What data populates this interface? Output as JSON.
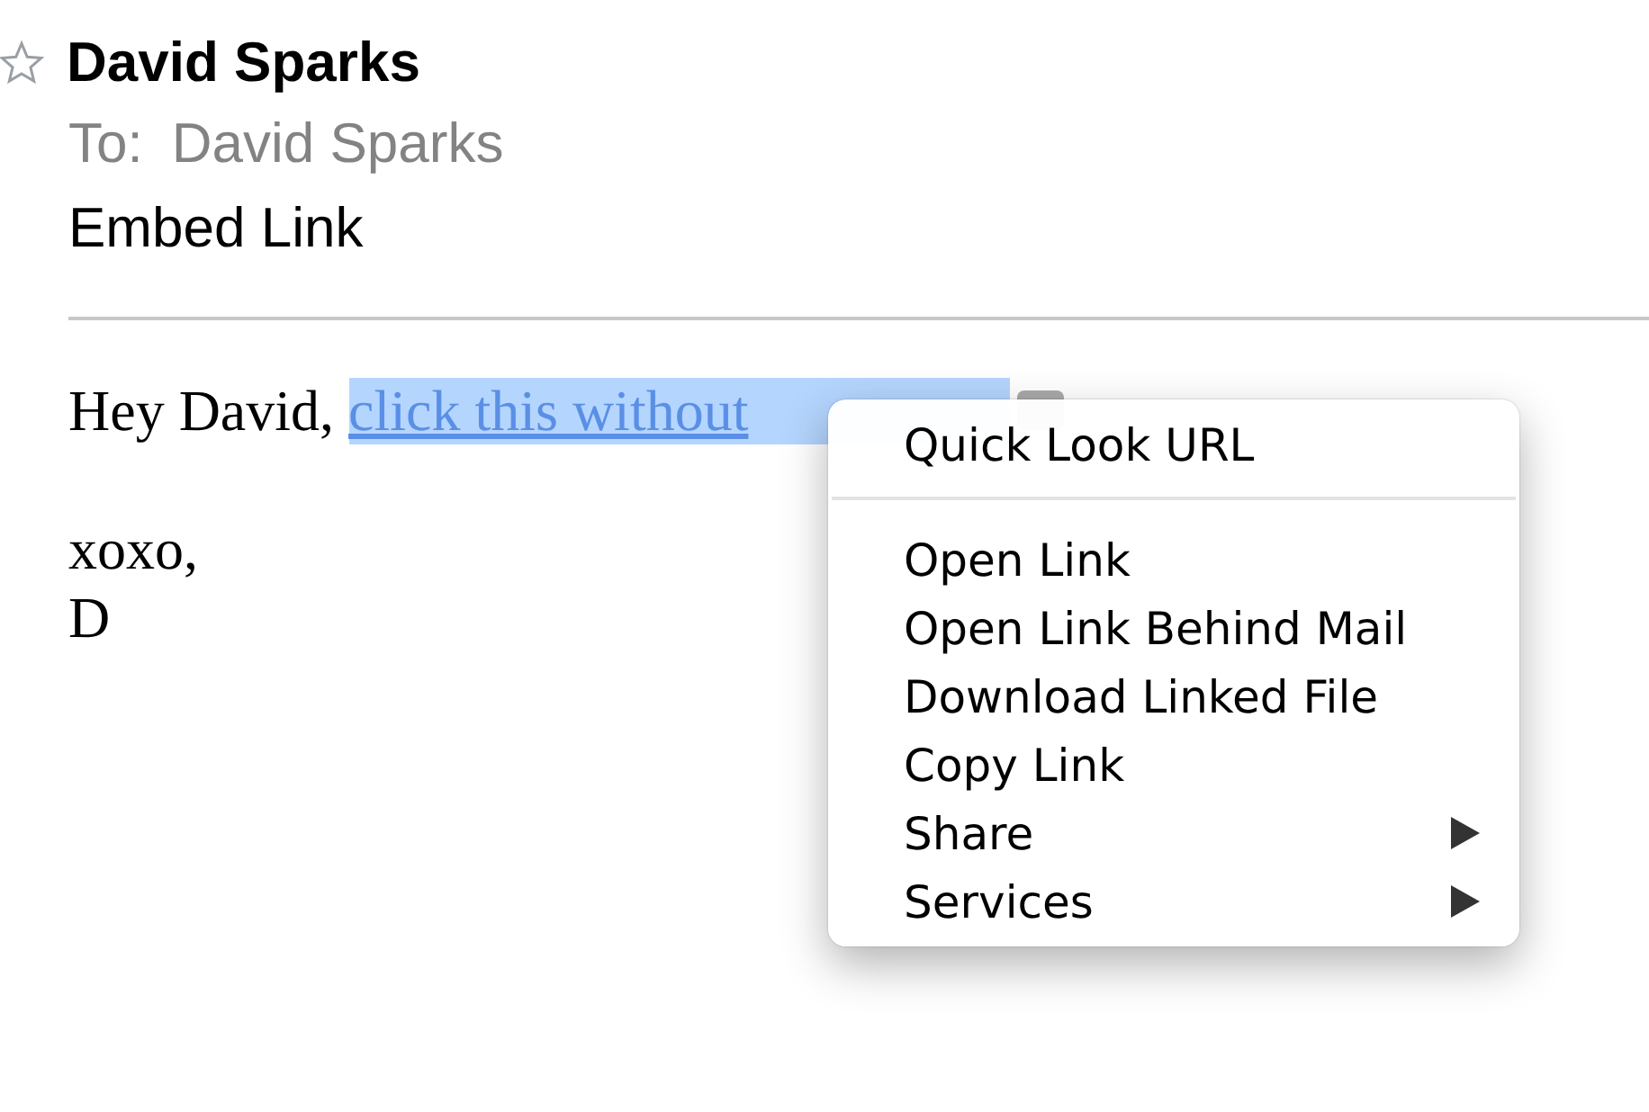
{
  "message": {
    "flagged": false,
    "sender": "David Sparks",
    "to_label": "To:",
    "to": "David Sparks",
    "subject": "Embed Link"
  },
  "body": {
    "greeting": "Hey David,",
    "link": "click this without",
    "link_selected": true,
    "lines": [
      "xoxo,",
      "D"
    ]
  },
  "context_menu": {
    "groups": [
      [
        {
          "label": "Quick Look URL",
          "submenu": false
        }
      ],
      [
        {
          "label": "Open Link",
          "submenu": false
        },
        {
          "label": "Open Link Behind Mail",
          "submenu": false
        },
        {
          "label": "Download Linked File",
          "submenu": false
        },
        {
          "label": "Copy Link",
          "submenu": false
        },
        {
          "label": "Share",
          "submenu": true
        },
        {
          "label": "Services",
          "submenu": true
        }
      ]
    ]
  }
}
